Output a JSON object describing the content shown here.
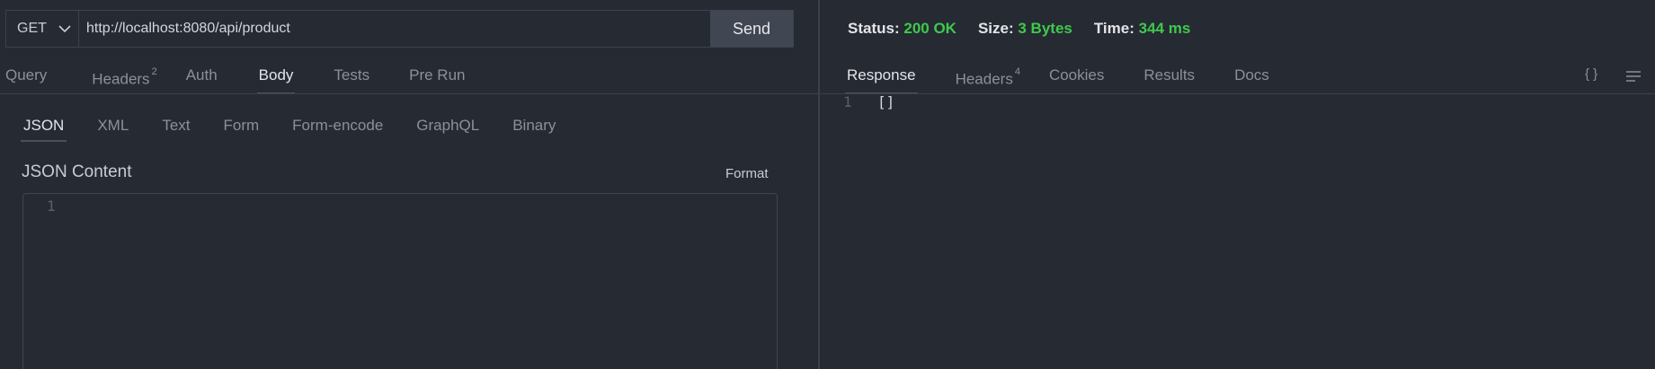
{
  "request": {
    "method": "GET",
    "url": "http://localhost:8080/api/product",
    "send_label": "Send",
    "tabs": [
      {
        "label": "Query",
        "badge": ""
      },
      {
        "label": "Headers",
        "badge": "2"
      },
      {
        "label": "Auth",
        "badge": ""
      },
      {
        "label": "Body",
        "badge": ""
      },
      {
        "label": "Tests",
        "badge": ""
      },
      {
        "label": "Pre Run",
        "badge": ""
      }
    ],
    "active_tab": "Body",
    "body_types": [
      "JSON",
      "XML",
      "Text",
      "Form",
      "Form-encode",
      "GraphQL",
      "Binary"
    ],
    "active_body_type": "JSON",
    "json_title": "JSON Content",
    "format_label": "Format",
    "editor_line": "1"
  },
  "response": {
    "status_label": "Status:",
    "status_value": "200 OK",
    "size_label": "Size:",
    "size_value": "3 Bytes",
    "time_label": "Time:",
    "time_value": "344 ms",
    "tabs": [
      {
        "label": "Response",
        "badge": ""
      },
      {
        "label": "Headers",
        "badge": "4"
      },
      {
        "label": "Cookies",
        "badge": ""
      },
      {
        "label": "Results",
        "badge": ""
      },
      {
        "label": "Docs",
        "badge": ""
      }
    ],
    "active_tab": "Response",
    "body_line": "1",
    "body_text": "[]",
    "braces_icon_text": "{ }"
  },
  "colors": {
    "background": "#262a33",
    "success": "#3ec94c",
    "send_button": "#404652"
  },
  "icons": [
    "chevron-down-icon",
    "braces-icon",
    "wrap-lines-icon"
  ]
}
